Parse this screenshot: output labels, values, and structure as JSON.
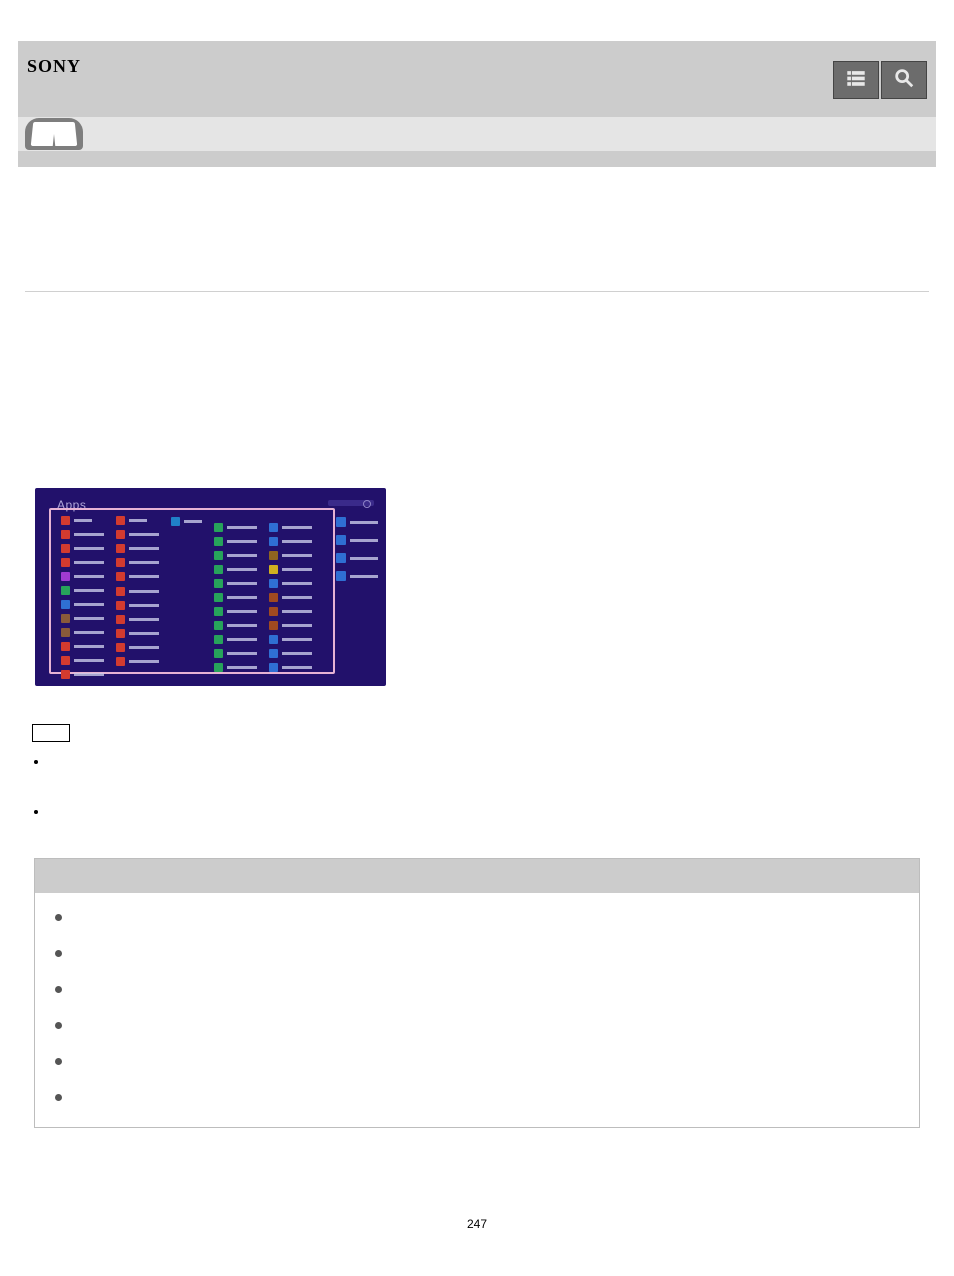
{
  "header": {
    "logo_text": "SONY",
    "icons": {
      "list": "list-icon",
      "search": "search-icon"
    }
  },
  "content": {
    "apps_screen": {
      "title": "Apps",
      "columns": [
        {
          "head_color": "#d33b2f",
          "tiles": [
            "#d33b2f",
            "#d33b2f",
            "#d33b2f",
            "#a03bd3",
            "#27a35b",
            "#2f6fd3",
            "#8a5a3a",
            "#8a5a3a",
            "#d33b2f",
            "#d33b2f",
            "#d33b2f"
          ]
        },
        {
          "head_color": "#d33b2f",
          "tiles": [
            "#d33b2f",
            "#d33b2f",
            "#d33b2f",
            "#d33b2f",
            "#d33b2f",
            "#d33b2f",
            "#d33b2f",
            "#d33b2f",
            "#d33b2f",
            "#d33b2f"
          ]
        },
        {
          "head_color": "#2080c8",
          "tiles": []
        },
        {
          "section": true,
          "tiles": [
            "#27a35b",
            "#27a35b",
            "#27a35b",
            "#27a35b",
            "#27a35b",
            "#27a35b",
            "#27a35b",
            "#27a35b",
            "#27a35b",
            "#27a35b",
            "#27a35b"
          ]
        },
        {
          "section": true,
          "tiles": [
            "#2f6fd3",
            "#2f6fd3",
            "#8f6520",
            "#d0b020",
            "#2f6fd3",
            "#a04a20",
            "#a04a20",
            "#a04a20",
            "#2f6fd3",
            "#2f6fd3",
            "#2f6fd3"
          ]
        }
      ],
      "outside": [
        "#2f6fd3",
        "#2f6fd3",
        "#2f6fd3",
        "#2f6fd3"
      ]
    },
    "hint_label": "",
    "tips": [
      "",
      ""
    ],
    "related": {
      "heading": "",
      "items": [
        "",
        "",
        "",
        "",
        "",
        ""
      ]
    }
  },
  "page_number": "247"
}
